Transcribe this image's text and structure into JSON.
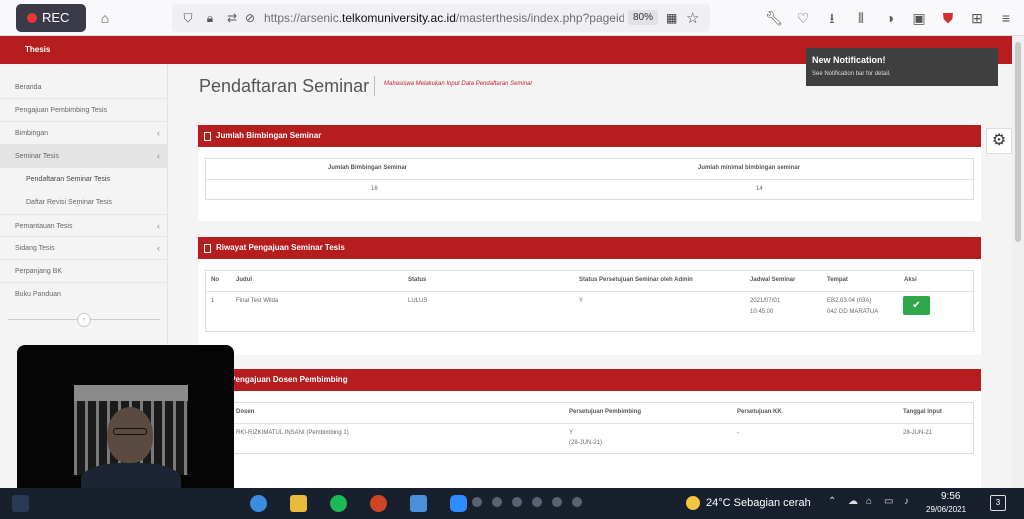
{
  "browser": {
    "rec_label": "REC",
    "url_host_prefix": "https://arsenic.",
    "url_host_main": "telkomuniversity.ac.id",
    "url_path": "/masterthesis/index.php?pageid=25",
    "zoom": "80%"
  },
  "app": {
    "title": "Thesis",
    "page_title": "Pendaftaran Seminar",
    "page_subtitle": "Mahasiswa Melakukan Input Data Pendaftaran Seminar"
  },
  "sidebar": {
    "items": [
      {
        "label": "Beranda"
      },
      {
        "label": "Pengajuan Pembimbing Tesis"
      },
      {
        "label": "Bimbingan"
      },
      {
        "label": "Seminar Tesis"
      },
      {
        "label": "Pendaftaran Seminar Tesis"
      },
      {
        "label": "Daftar Revisi Seminar Tesis"
      },
      {
        "label": "Pemantauan Tesis"
      },
      {
        "label": "Sidang Tesis"
      },
      {
        "label": "Perpanjang BK"
      },
      {
        "label": "Buku Panduan"
      }
    ]
  },
  "panel1": {
    "title": "Jumlah Bimbingan Seminar",
    "col1": "Jumlah Bimbingan Seminar",
    "col2": "Jumlah minimal bimbingan seminar",
    "val1": "16",
    "val2": "14"
  },
  "panel2": {
    "title": "Riwayat Pengajuan Seminar Tesis",
    "headers": [
      "No",
      "Judul",
      "Status",
      "Status Persetujuan Seminar oleh Admin",
      "Jadwal Seminar",
      "Tempat",
      "Aksi"
    ],
    "row": {
      "no": "1",
      "judul": "Final Test Wilda",
      "status": "LULUS",
      "admin": "Y",
      "jadwal_date": "2021/07/01",
      "jadwal_time": "10:45:00",
      "tempat1": "EB2.03.04 (03A)",
      "tempat2": "042 GD MARATUA",
      "aksi": "✔"
    }
  },
  "panel3": {
    "title": "tus Pengajuan Dosen Pembimbing",
    "headers": [
      "Dosen",
      "Persetujuan Pembimbing",
      "Persetujuan KK",
      "Tanggal Input"
    ],
    "row": {
      "dosen": "RKI-RIZKIMATUL INSANI (Pembimbing 1)",
      "persetujuan": "Y",
      "persetujuan_date": "(28-JUN-21)",
      "kk": "-",
      "tanggal": "28-JUN-21"
    }
  },
  "notification": {
    "title": "New Notification!",
    "text": "See Notification bar for detail."
  },
  "taskbar": {
    "weather": "24°C  Sebagian cerah",
    "time": "9:56",
    "date": "29/06/2021",
    "notif_count": "3"
  }
}
